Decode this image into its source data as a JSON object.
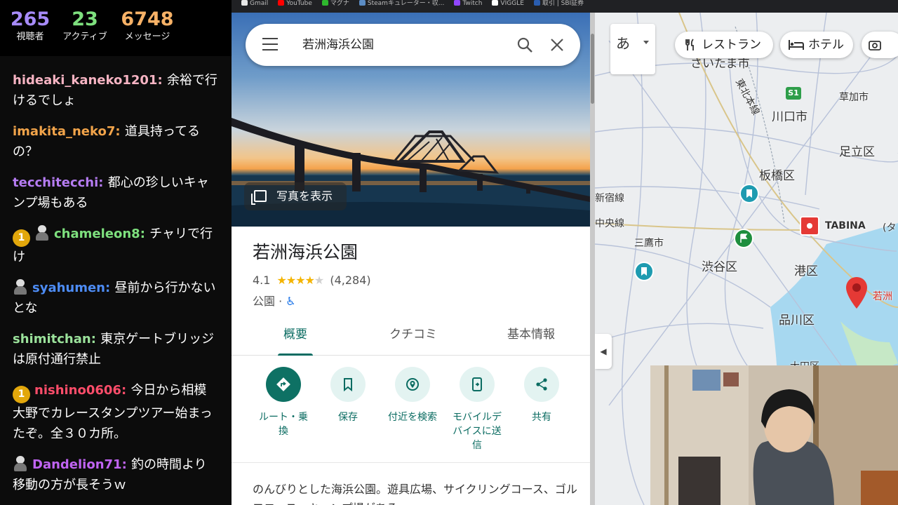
{
  "stream_stats": {
    "viewers": {
      "value": "265",
      "label": "視聴者"
    },
    "active": {
      "value": "23",
      "label": "アクティブ"
    },
    "messages": {
      "value": "6748",
      "label": "メッセージ"
    }
  },
  "chat": [
    {
      "user": "hideaki_kaneko1201",
      "text": "余裕で行けるでしょ",
      "color": "#f7b4c3",
      "badge": "",
      "avatar": false
    },
    {
      "user": "imakita_neko7",
      "text": "道具持ってるの？",
      "color": "#f2a44a",
      "badge": "",
      "avatar": false
    },
    {
      "user": "tecchitecchi",
      "text": "都心の珍しいキャンプ場もある",
      "color": "#b57cf2",
      "badge": "",
      "avatar": false
    },
    {
      "user": "chameleon8",
      "text": "チャリで行け",
      "color": "#7ee07e",
      "badge": "1",
      "avatar": true
    },
    {
      "user": "syahumen",
      "text": "昼前から行かないとな",
      "color": "#4d8cf5",
      "badge": "",
      "avatar": true
    },
    {
      "user": "shimitchan",
      "text": "東京ゲートブリッジは原付通行禁止",
      "color": "#9be29b",
      "badge": "",
      "avatar": false
    },
    {
      "user": "nishino0606",
      "text": "今日から相模大野でカレースタンプツアー始まったぞ。全３０カ所。",
      "color": "#ff4d6a",
      "badge": "1",
      "avatar": false
    },
    {
      "user": "Dandelion71",
      "text": "釣の時間より移動の方が長そうｗ",
      "color": "#c064f2",
      "badge": "",
      "avatar": true
    }
  ],
  "bookmarks": [
    {
      "label": "Gmail",
      "color": "#e8e8e8"
    },
    {
      "label": "YouTube",
      "color": "#ff0000"
    },
    {
      "label": "マグナ",
      "color": "#2eb82e"
    },
    {
      "label": "Steamキュレーター・収...",
      "color": "#5b8cc4"
    },
    {
      "label": "Twitch",
      "color": "#9146ff"
    },
    {
      "label": "VIGGLE",
      "color": "#ffffff"
    },
    {
      "label": "取引 | SBI証券",
      "color": "#2a5db0"
    }
  ],
  "search": {
    "query": "若洲海浜公園"
  },
  "photo_button": "写真を表示",
  "place": {
    "name": "若洲海浜公園",
    "rating": "4.1",
    "review_count": "(4,284)",
    "category": "公園",
    "accessible_icon": "wheelchair-icon"
  },
  "tabs": [
    {
      "label": "概要",
      "active": true
    },
    {
      "label": "クチコミ",
      "active": false
    },
    {
      "label": "基本情報",
      "active": false
    }
  ],
  "actions": {
    "route": {
      "label": "ルート・乗\n換",
      "icon": "directions-icon"
    },
    "save": {
      "label": "保存",
      "icon": "bookmark-icon"
    },
    "nearby": {
      "label": "付近を検索",
      "icon": "nearby-search-icon"
    },
    "send": {
      "label": "モバイルデ\nバイスに送\n信",
      "icon": "send-to-phone-icon"
    },
    "share": {
      "label": "共有",
      "icon": "share-icon"
    }
  },
  "description": "のんびりとした海浜公園。遊具広場、サイクリングコース、ゴルフコース、キャンプ場がある。",
  "map": {
    "lang_button": "あ",
    "chips": {
      "restaurant": "レストラン",
      "hotel": "ホテル"
    },
    "labels": {
      "saitama": "さいたま市",
      "tohoku": "東北本線",
      "souka": "草加市",
      "kawaguchi": "川口市",
      "adachi": "足立区",
      "itabashi": "板橋区",
      "shinjuku_line": "新宿線",
      "chuo_line": "中央線",
      "mitaka": "三鷹市",
      "shibuya": "渋谷区",
      "minato": "港区",
      "shinagawa": "品川区",
      "ota": "大田区",
      "tabina": "TABINA",
      "tabina_cut": "(タ",
      "s1": "S1",
      "marker": "若洲"
    }
  },
  "colors": {
    "accent": "#0b6c62",
    "star": "#f4b400",
    "marker_red": "#e53935"
  }
}
